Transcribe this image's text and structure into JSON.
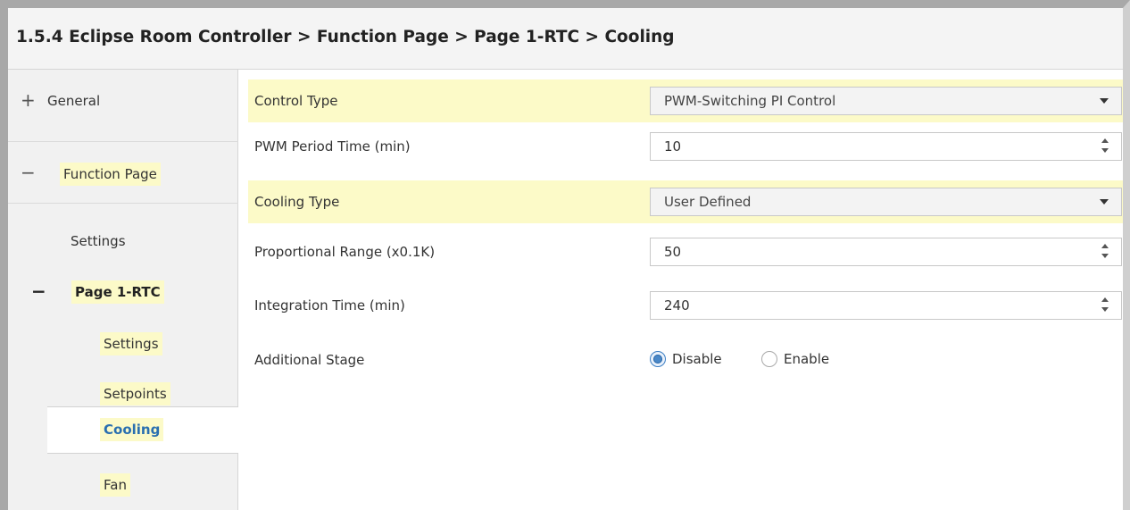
{
  "breadcrumb": "1.5.4 Eclipse Room Controller > Function Page > Page 1-RTC > Cooling",
  "sidebar": {
    "items": [
      {
        "sign": "+",
        "label": "General"
      },
      {
        "sign": "−",
        "label": "Function Page"
      },
      {
        "sign": "",
        "label": "Settings"
      },
      {
        "sign": "−",
        "label": "Page 1-RTC"
      },
      {
        "sign": "",
        "label": "Settings"
      },
      {
        "sign": "",
        "label": "Setpoints"
      },
      {
        "sign": "",
        "label": "Cooling"
      },
      {
        "sign": "",
        "label": "Fan"
      }
    ],
    "selected": "Cooling"
  },
  "params": [
    {
      "label": "Control Type",
      "type": "select",
      "value": "PWM-Switching PI Control"
    },
    {
      "label": "PWM Period Time (min)",
      "type": "spin",
      "value": "10"
    },
    {
      "label": "Cooling Type",
      "type": "select",
      "value": "User Defined"
    },
    {
      "label": "Proportional Range (x0.1K)",
      "type": "spin",
      "value": "50"
    },
    {
      "label": "Integration Time (min)",
      "type": "spin",
      "value": "240"
    },
    {
      "label": "Additional Stage",
      "type": "radio",
      "options": [
        "Disable",
        "Enable"
      ],
      "selected": "Disable"
    }
  ],
  "colors": {
    "highlight": "#fcfac8",
    "selected_text": "#2a6fb0",
    "radio_accent": "#4a88c8"
  }
}
